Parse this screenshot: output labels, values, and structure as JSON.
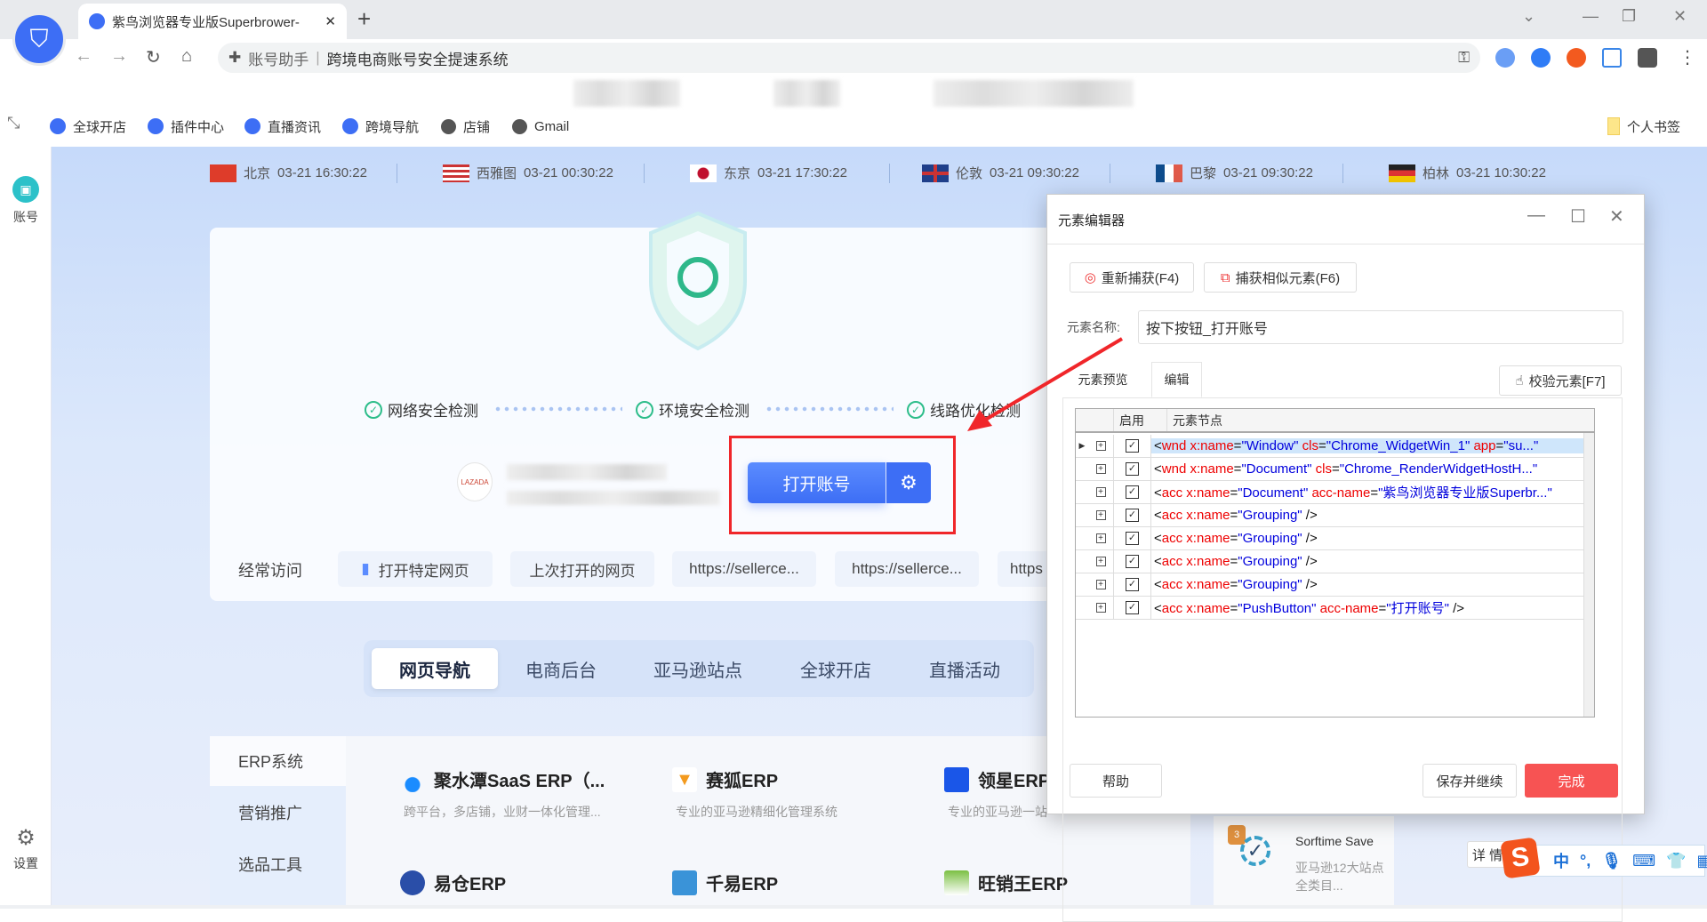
{
  "browser": {
    "tab_title": "紫鸟浏览器专业版Superbrower-",
    "address_prefix": "账号助手",
    "address_text": "跨境电商账号安全提速系统",
    "bookmarks": [
      "全球开店",
      "插件中心",
      "直播资讯",
      "跨境导航",
      "店铺",
      "Gmail"
    ],
    "bookmark_folder": "个人书签"
  },
  "sidebar": {
    "account_label": "账号",
    "settings_label": "设置"
  },
  "clocks": [
    {
      "city": "北京",
      "time": "03-21 16:30:22",
      "flag": "cn"
    },
    {
      "city": "西雅图",
      "time": "03-21 00:30:22",
      "flag": "us"
    },
    {
      "city": "东京",
      "time": "03-21 17:30:22",
      "flag": "jp"
    },
    {
      "city": "伦敦",
      "time": "03-21 09:30:22",
      "flag": "uk"
    },
    {
      "city": "巴黎",
      "time": "03-21 09:30:22",
      "flag": "fr"
    },
    {
      "city": "柏林",
      "time": "03-21 10:30:22",
      "flag": "de"
    }
  ],
  "checks": [
    "网络安全检测",
    "环境安全检测",
    "线路优化检测"
  ],
  "store_logo": "LAZADA",
  "open_account_label": "打开账号",
  "frequent": {
    "label": "经常访问",
    "items": [
      "打开特定网页",
      "上次打开的网页",
      "https://sellerce...",
      "https://sellerce...",
      "https"
    ]
  },
  "nav_tabs": [
    "网页导航",
    "电商后台",
    "亚马逊站点",
    "全球开店",
    "直播活动"
  ],
  "categories": [
    "ERP系统",
    "营销推广",
    "选品工具"
  ],
  "erp": [
    {
      "name": "聚水潭SaaS ERP（...",
      "desc": "跨平台，多店铺，业财一体化管理..."
    },
    {
      "name": "赛狐ERP",
      "desc": "专业的亚马逊精细化管理系统"
    },
    {
      "name": "领星ERP",
      "desc": "专业的亚马逊一站"
    },
    {
      "name": "易仓ERP",
      "desc": ""
    },
    {
      "name": "千易ERP",
      "desc": ""
    },
    {
      "name": "旺销王ERP",
      "desc": ""
    }
  ],
  "sorftime": {
    "name": "Sorftime Save",
    "desc": "亚马逊12大站点全类目...",
    "detail": "详 情",
    "badge": "3"
  },
  "dialog": {
    "title": "元素编辑器",
    "recapture": "重新捕获(F4)",
    "capture_similar": "捕获相似元素(F6)",
    "name_label": "元素名称:",
    "name_value": "按下按钮_打开账号",
    "tabs": [
      "元素预览",
      "编辑"
    ],
    "verify": "校验元素[F7]",
    "col_enable": "启用",
    "col_node": "元素节点",
    "rows": [
      {
        "tag": "wnd",
        "parts": [
          [
            "x:name",
            "Window"
          ],
          [
            "cls",
            "Chrome_WidgetWin_1"
          ],
          [
            "app",
            "su..."
          ]
        ],
        "tail": ""
      },
      {
        "tag": "wnd",
        "parts": [
          [
            "x:name",
            "Document"
          ],
          [
            "cls",
            "Chrome_RenderWidgetHostH..."
          ]
        ],
        "tail": ""
      },
      {
        "tag": "acc",
        "parts": [
          [
            "x:name",
            "Document"
          ],
          [
            "acc-name",
            "紫鸟浏览器专业版Superbr..."
          ]
        ],
        "tail": ""
      },
      {
        "tag": "acc",
        "parts": [
          [
            "x:name",
            "Grouping"
          ]
        ],
        "tail": " />"
      },
      {
        "tag": "acc",
        "parts": [
          [
            "x:name",
            "Grouping"
          ]
        ],
        "tail": " />"
      },
      {
        "tag": "acc",
        "parts": [
          [
            "x:name",
            "Grouping"
          ]
        ],
        "tail": " />"
      },
      {
        "tag": "acc",
        "parts": [
          [
            "x:name",
            "Grouping"
          ]
        ],
        "tail": " />"
      },
      {
        "tag": "acc",
        "parts": [
          [
            "x:name",
            "PushButton"
          ],
          [
            "acc-name",
            "打开账号"
          ]
        ],
        "tail": " />"
      }
    ],
    "help": "帮助",
    "save_continue": "保存并继续",
    "done": "完成"
  },
  "ime": {
    "mode": "中",
    "punct": "°,"
  },
  "colors": {
    "accent": "#3d6ef5",
    "danger": "#f75353",
    "highlight": "#f0262a"
  }
}
